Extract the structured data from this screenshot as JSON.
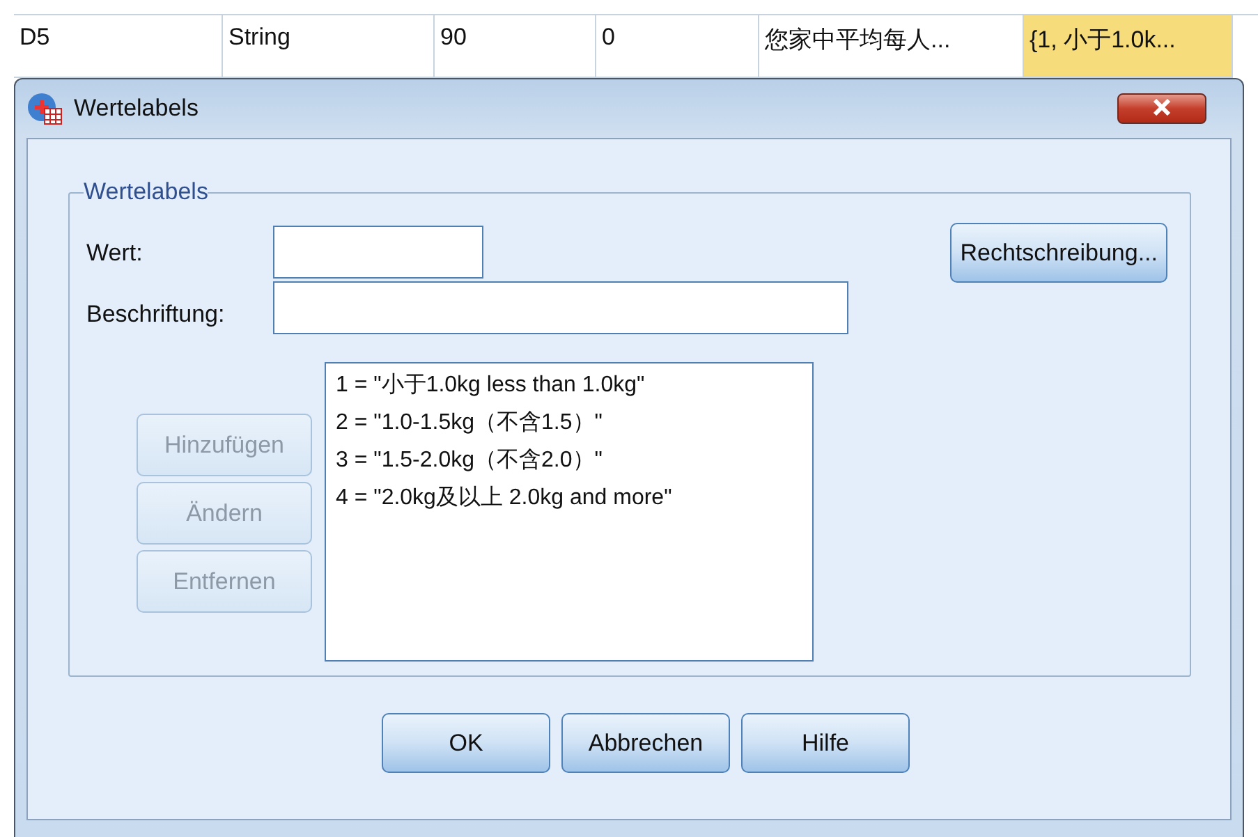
{
  "sheet_row": {
    "cells": [
      {
        "text": "D5",
        "selected": false
      },
      {
        "text": "String",
        "selected": false
      },
      {
        "text": "90",
        "selected": false
      },
      {
        "text": "0",
        "selected": false
      },
      {
        "text": "您家中平均每人...",
        "selected": false
      },
      {
        "text": "{1, 小于1.0k...",
        "selected": true
      }
    ]
  },
  "dialog": {
    "title": "Wertelabels",
    "group_title": "Wertelabels",
    "value_label": "Wert:",
    "label_label": "Beschriftung:",
    "spelling_button": {
      "label": "Rechtschreibung...",
      "disabled": false
    },
    "action_buttons": [
      {
        "label": "Hinzufügen",
        "disabled": true
      },
      {
        "label": "Ändern",
        "disabled": true
      },
      {
        "label": "Entfernen",
        "disabled": true
      }
    ],
    "labels_list": [
      {
        "text": "1 = \"小于1.0kg less than 1.0kg\""
      },
      {
        "text": "2 = \"1.0-1.5kg（不含1.5）\""
      },
      {
        "text": "3 = \"1.5-2.0kg（不含2.0）\""
      },
      {
        "text": "4 = \"2.0kg及以上 2.0kg and more\""
      }
    ],
    "footer_buttons": [
      {
        "label": "OK",
        "disabled": false
      },
      {
        "label": "Abbrechen",
        "disabled": false
      },
      {
        "label": "Hilfe",
        "disabled": false
      }
    ]
  }
}
